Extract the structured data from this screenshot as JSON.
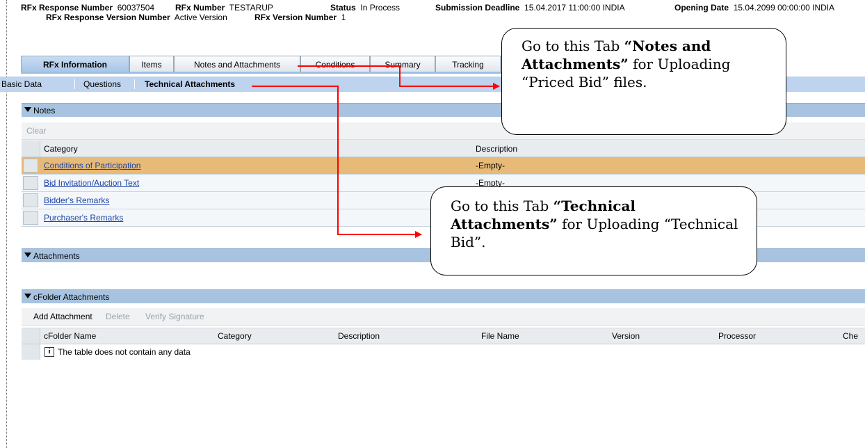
{
  "header": {
    "response_number_label": "RFx Response Number",
    "response_number": "60037504",
    "rfx_number_label": "RFx Number",
    "rfx_number": "TESTARUP",
    "status_label": "Status",
    "status": "In Process",
    "submission_label": "Submission Deadline",
    "submission": "15.04.2017 11:00:00 INDIA",
    "opening_label": "Opening Date",
    "opening": "15.04.2099 00:00:00 INDIA",
    "response_version_label": "RFx Response Version Number",
    "response_version": "Active Version",
    "rfx_version_label": "RFx Version Number",
    "rfx_version": "1"
  },
  "tabs": [
    "RFx Information",
    "Items",
    "Notes and Attachments",
    "Conditions",
    "Summary",
    "Tracking"
  ],
  "subnav": [
    "Basic Data",
    "Questions",
    "Technical Attachments"
  ],
  "notes": {
    "title": "Notes",
    "toolbar_clear": "Clear",
    "col_category": "Category",
    "col_description": "Description",
    "rows": [
      {
        "category": "Conditions of Participation",
        "description": "-Empty-"
      },
      {
        "category": "Bid Invitation/Auction Text",
        "description": "-Empty-"
      },
      {
        "category": "Bidder's Remarks",
        "description": ""
      },
      {
        "category": "Purchaser's Remarks",
        "description": ""
      }
    ]
  },
  "attachments": {
    "title": "Attachments"
  },
  "cfolder": {
    "title": "cFolder Attachments",
    "add": "Add Attachment",
    "delete": "Delete",
    "verify": "Verify Signature",
    "columns": [
      "cFolder Name",
      "Category",
      "Description",
      "File Name",
      "Version",
      "Processor",
      "Che"
    ],
    "empty_message": "The table does not contain any data"
  },
  "callouts": {
    "notes": {
      "pre": "Go to this Tab ",
      "bold": "“Notes and Attachments”",
      "post": " for Uploading “Priced Bid” files."
    },
    "technical": {
      "pre": "Go to this Tab ",
      "bold": "“Technical Attachments”",
      "post": " for Uploading “Technical Bid”."
    }
  },
  "colors": {
    "arrow": "#ff0000",
    "highlight_row": "#e7ba78",
    "section_bar": "#a7c3e0",
    "subnav": "#bdd3ee"
  }
}
